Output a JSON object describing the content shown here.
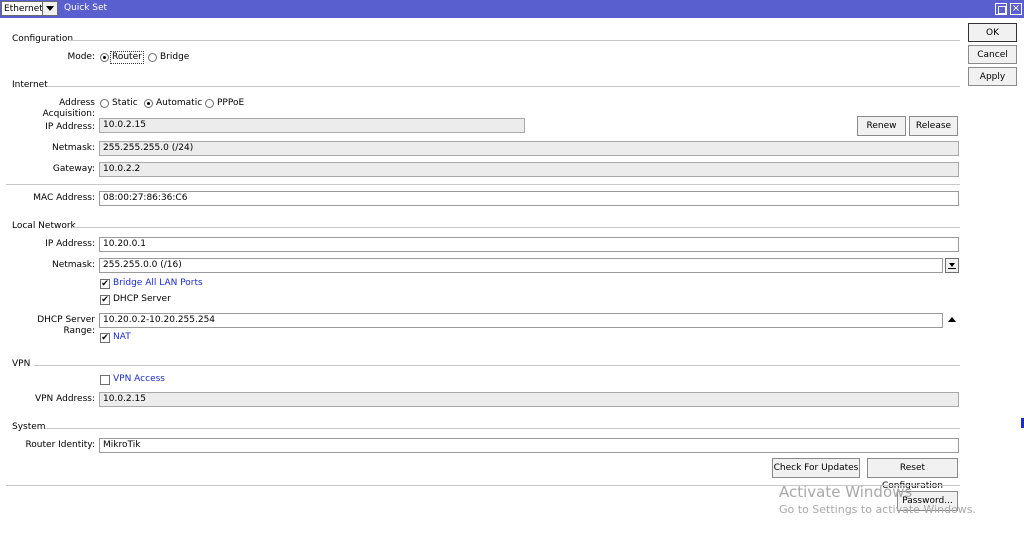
{
  "titlebar": {
    "mode_value": "Ethernet",
    "title": "Quick Set",
    "color": "#5a5fd0"
  },
  "actions": {
    "ok": "OK",
    "cancel": "Cancel",
    "apply": "Apply"
  },
  "configuration": {
    "group": "Configuration",
    "mode_label": "Mode:",
    "modes": [
      {
        "label": "Router",
        "selected": true
      },
      {
        "label": "Bridge",
        "selected": false
      }
    ]
  },
  "internet": {
    "group": "Internet",
    "acq_label": "Address Acquisition:",
    "acq_options": [
      {
        "label": "Static",
        "selected": false
      },
      {
        "label": "Automatic",
        "selected": true
      },
      {
        "label": "PPPoE",
        "selected": false
      }
    ],
    "ip_label": "IP Address:",
    "ip_value": "10.0.2.15",
    "renew": "Renew",
    "release": "Release",
    "netmask_label": "Netmask:",
    "netmask_value": "255.255.255.0 (/24)",
    "gateway_label": "Gateway:",
    "gateway_value": "10.0.2.2",
    "mac_label": "MAC Address:",
    "mac_value": "08:00:27:86:36:C6"
  },
  "local_network": {
    "group": "Local Network",
    "ip_label": "IP Address:",
    "ip_value": "10.20.0.1",
    "netmask_label": "Netmask:",
    "netmask_value": "255.255.0.0 (/16)",
    "bridge_all": {
      "label": "Bridge All LAN Ports",
      "checked": true
    },
    "dhcp_server": {
      "label": "DHCP Server",
      "checked": true
    },
    "dhcp_range_label": "DHCP Server Range:",
    "dhcp_range_value": "10.20.0.2-10.20.255.254",
    "nat": {
      "label": "NAT",
      "checked": true
    }
  },
  "vpn": {
    "group": "VPN",
    "access": {
      "label": "VPN Access",
      "checked": false
    },
    "address_label": "VPN Address:",
    "address_value": "10.0.2.15"
  },
  "system": {
    "group": "System",
    "identity_label": "Router Identity:",
    "identity_value": "MikroTik",
    "check_updates": "Check For Updates",
    "reset_config": "Reset Configuration",
    "password": "Password..."
  },
  "watermark": {
    "line1": "Activate Windows",
    "line2": "Go to Settings to activate Windows."
  },
  "check_mark": "✔"
}
